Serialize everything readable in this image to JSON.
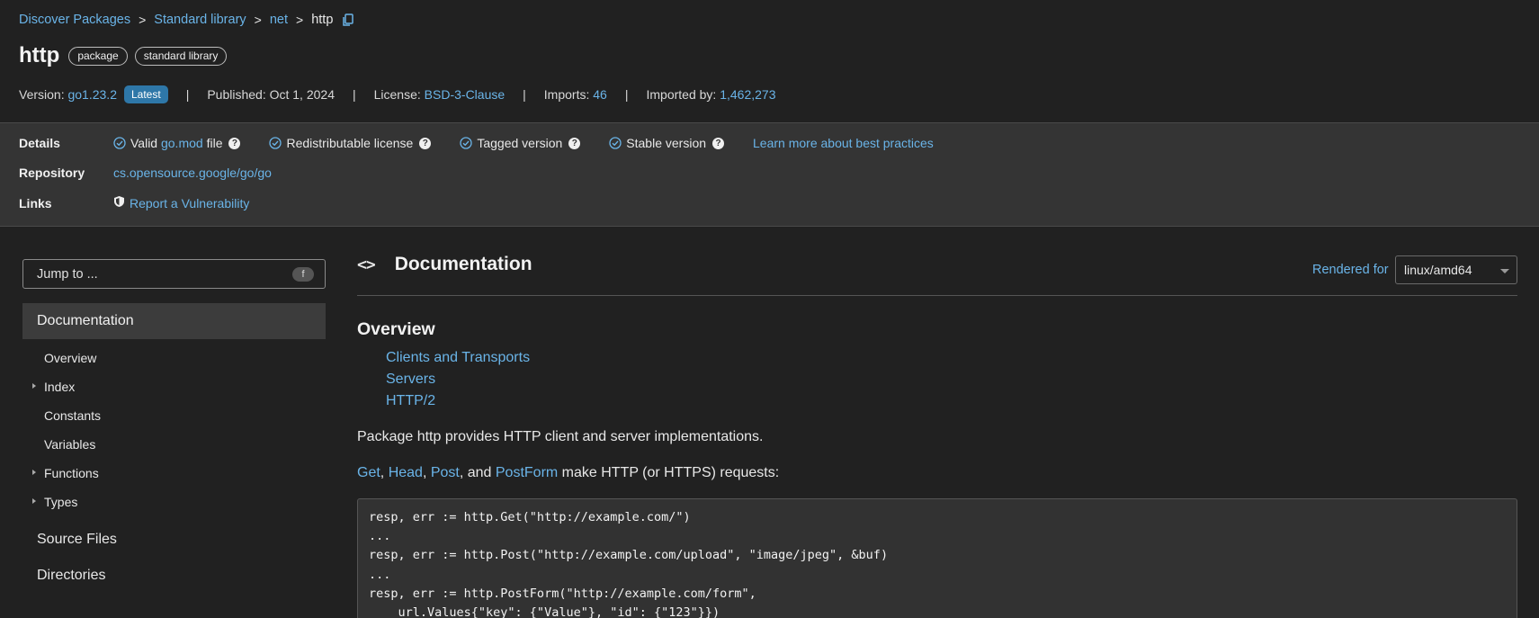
{
  "breadcrumb": {
    "items": [
      "Discover Packages",
      "Standard library",
      "net"
    ],
    "current": "http",
    "separator": ">"
  },
  "header": {
    "title": "http",
    "chips": [
      "package",
      "standard library"
    ]
  },
  "meta": {
    "version_label": "Version:",
    "version_value": "go1.23.2",
    "latest_badge": "Latest",
    "published": "Published: Oct 1, 2024",
    "license_label": "License:",
    "license_value": "BSD-3-Clause",
    "imports_label": "Imports:",
    "imports_value": "46",
    "imported_by_label": "Imported by:",
    "imported_by_value": "1,462,273",
    "separator": "|"
  },
  "details": {
    "details_label": "Details",
    "valid_prefix": "Valid",
    "gomod_link": "go.mod",
    "valid_suffix": "file",
    "redistributable": "Redistributable license",
    "tagged": "Tagged version",
    "stable": "Stable version",
    "learn_more": "Learn more about best practices",
    "repository_label": "Repository",
    "repository_link": "cs.opensource.google/go/go",
    "links_label": "Links",
    "vuln_link": "Report a Vulnerability"
  },
  "sidebar": {
    "jump_placeholder": "Jump to ...",
    "jump_key": "f",
    "documentation": "Documentation",
    "items": [
      "Overview",
      "Index",
      "Constants",
      "Variables",
      "Functions",
      "Types"
    ],
    "source_files": "Source Files",
    "directories": "Directories"
  },
  "main": {
    "doc_title": "Documentation",
    "rendered_for_label": "Rendered for",
    "platform": "linux/amd64",
    "overview_heading": "Overview",
    "overview_links": [
      "Clients and Transports",
      "Servers",
      "HTTP/2"
    ],
    "intro": "Package http provides HTTP client and server implementations.",
    "funcs": [
      "Get",
      "Head",
      "Post",
      "PostForm"
    ],
    "funcs_sep1": ", ",
    "funcs_and": ", and ",
    "funcs_suffix": " make HTTP (or HTTPS) requests:",
    "code_lines": [
      "resp, err := http.Get(\"http://example.com/\")",
      "...",
      "resp, err := http.Post(\"http://example.com/upload\", \"image/jpeg\", &buf)",
      "...",
      "resp, err := http.PostForm(\"http://example.com/form\",",
      "    url.Values{\"key\": {\"Value\"}, \"id\": {\"123\"}})"
    ]
  },
  "colors": {
    "background": "#212121",
    "details_band": "#343434",
    "link": "#6ab4e8",
    "latest_badge": "#2e77a8"
  }
}
